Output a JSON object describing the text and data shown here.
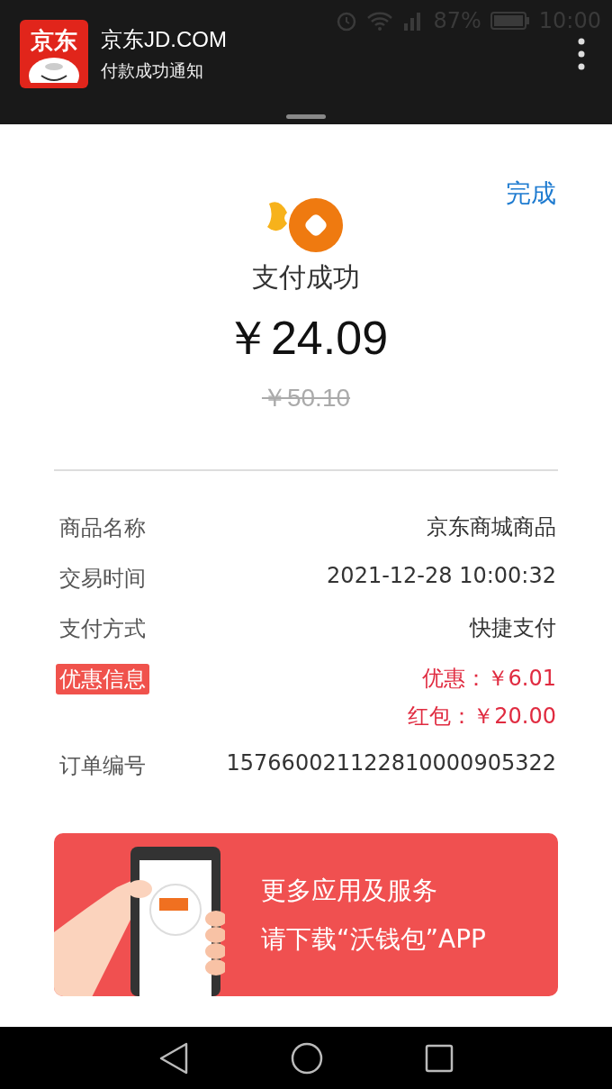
{
  "status_bar": {
    "battery": "87%",
    "time": "10:00"
  },
  "notification": {
    "app_icon_text": "京东",
    "app_name": "京东JD.COM",
    "message": "付款成功通知"
  },
  "done_button": "完成",
  "result": {
    "title": "支付成功",
    "amount": "￥24.09",
    "original_amount": "￥50.10"
  },
  "details": [
    {
      "label": "商品名称",
      "highlighted": false,
      "values": [
        {
          "text": "京东商城商品",
          "kind": "plain"
        }
      ]
    },
    {
      "label": "交易时间",
      "highlighted": false,
      "values": [
        {
          "text": "2021-12-28 10:00:32",
          "kind": "plain"
        }
      ]
    },
    {
      "label": "支付方式",
      "highlighted": false,
      "values": [
        {
          "text": "快捷支付",
          "kind": "plain"
        }
      ]
    },
    {
      "label": "优惠信息",
      "highlighted": true,
      "values": [
        {
          "text": "优惠：￥6.01",
          "kind": "discount"
        },
        {
          "text": "红包：￥20.00",
          "kind": "discount"
        }
      ]
    },
    {
      "label": "订单编号",
      "highlighted": false,
      "values": [
        {
          "text": "157660021122810000905322",
          "kind": "plain"
        }
      ]
    }
  ],
  "ad_banner": {
    "line_1": "更多应用及服务",
    "line_2": "请下载“沃钱包”APP"
  }
}
